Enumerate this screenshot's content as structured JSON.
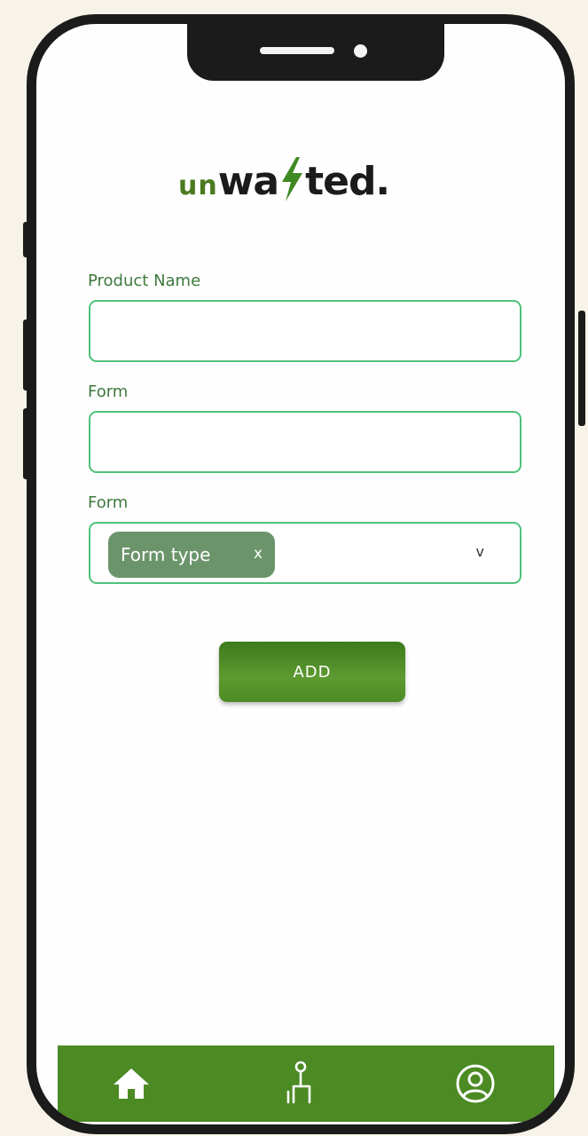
{
  "logo": {
    "prefix": "un",
    "part1": "wa",
    "part2": "ted."
  },
  "form": {
    "product_name_label": "Product Name",
    "product_name_value": "",
    "form_label_1": "Form",
    "form_value_1": "",
    "form_label_2": "Form",
    "form_type_chip": "Form type",
    "chip_remove": "x",
    "dropdown_arrow": "v",
    "add_button": "ADD"
  },
  "nav": {
    "items": [
      {
        "name": "home",
        "icon": "home-icon"
      },
      {
        "name": "donate",
        "icon": "person-podium-icon"
      },
      {
        "name": "profile",
        "icon": "user-circle-icon"
      }
    ]
  },
  "colors": {
    "accent_green": "#4c8a24",
    "field_border": "#4ec27a",
    "label_green": "#3f7a3e",
    "chip_green": "#6b946a",
    "frame": "#1b1b1b",
    "page_bg": "#f8f3e8"
  }
}
